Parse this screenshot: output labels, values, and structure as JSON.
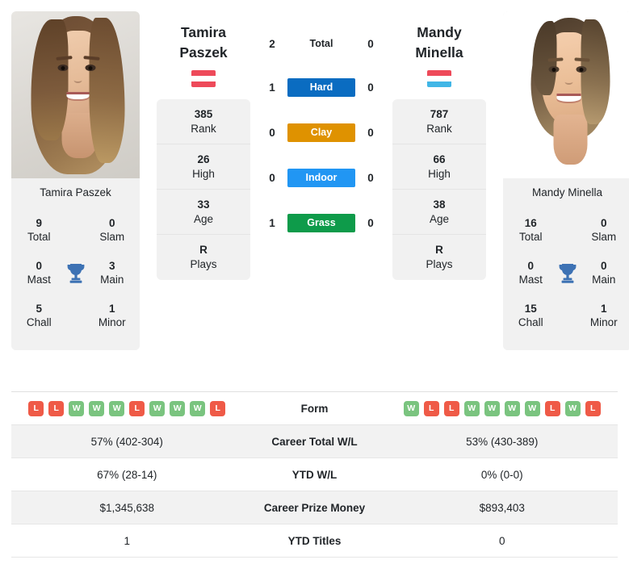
{
  "players": {
    "left": {
      "first_name": "Tamira",
      "last_name": "Paszek",
      "full_name": "Tamira Paszek",
      "country_flag": "austria-flag",
      "flag_colors": [
        "#ee4a5a",
        "#ffffff",
        "#ee4a5a"
      ],
      "titles": {
        "total_value": "9",
        "total_label": "Total",
        "slam_value": "0",
        "slam_label": "Slam",
        "mast_value": "0",
        "mast_label": "Mast",
        "main_value": "3",
        "main_label": "Main",
        "chall_value": "5",
        "chall_label": "Chall",
        "minor_value": "1",
        "minor_label": "Minor"
      },
      "stats": [
        {
          "value": "385",
          "label": "Rank"
        },
        {
          "value": "26",
          "label": "High"
        },
        {
          "value": "33",
          "label": "Age"
        },
        {
          "value": "R",
          "label": "Plays"
        }
      ],
      "h2h": {
        "total": "2",
        "hard": "1",
        "clay": "0",
        "indoor": "0",
        "grass": "1"
      },
      "form": [
        "L",
        "L",
        "W",
        "W",
        "W",
        "L",
        "W",
        "W",
        "W",
        "L"
      ],
      "career_total_wl": "57% (402-304)",
      "ytd_wl": "67% (28-14)",
      "career_prize_money": "$1,345,638",
      "ytd_titles": "1"
    },
    "right": {
      "first_name": "Mandy",
      "last_name": "Minella",
      "full_name": "Mandy Minella",
      "country_flag": "luxembourg-flag",
      "flag_colors": [
        "#ee4a5a",
        "#ffffff",
        "#41b6e6"
      ],
      "titles": {
        "total_value": "16",
        "total_label": "Total",
        "slam_value": "0",
        "slam_label": "Slam",
        "mast_value": "0",
        "mast_label": "Mast",
        "main_value": "0",
        "main_label": "Main",
        "chall_value": "15",
        "chall_label": "Chall",
        "minor_value": "1",
        "minor_label": "Minor"
      },
      "stats": [
        {
          "value": "787",
          "label": "Rank"
        },
        {
          "value": "66",
          "label": "High"
        },
        {
          "value": "38",
          "label": "Age"
        },
        {
          "value": "R",
          "label": "Plays"
        }
      ],
      "h2h": {
        "total": "0",
        "hard": "0",
        "clay": "0",
        "indoor": "0",
        "grass": "0"
      },
      "form": [
        "W",
        "L",
        "L",
        "W",
        "W",
        "W",
        "W",
        "L",
        "W",
        "L"
      ],
      "career_total_wl": "53% (430-389)",
      "ytd_wl": "0% (0-0)",
      "career_prize_money": "$893,403",
      "ytd_titles": "0"
    }
  },
  "h2h_rows": {
    "total_label": "Total",
    "hard_label": "Hard",
    "clay_label": "Clay",
    "indoor_label": "Indoor",
    "grass_label": "Grass"
  },
  "surface_colors": {
    "hard": "#0A6CC1",
    "clay": "#DF9200",
    "indoor": "#2196F3",
    "grass": "#0E9B4A"
  },
  "table": {
    "form_label": "Form",
    "career_total_wl_label": "Career Total W/L",
    "ytd_wl_label": "YTD W/L",
    "career_prize_money_label": "Career Prize Money",
    "ytd_titles_label": "YTD Titles"
  },
  "icons": {
    "trophy": "trophy-icon"
  },
  "colors": {
    "win_badge": "#7ac47f",
    "loss_badge": "#ef5a47",
    "card_background": "#f1f1f1",
    "trophy": "#3d72b4"
  }
}
